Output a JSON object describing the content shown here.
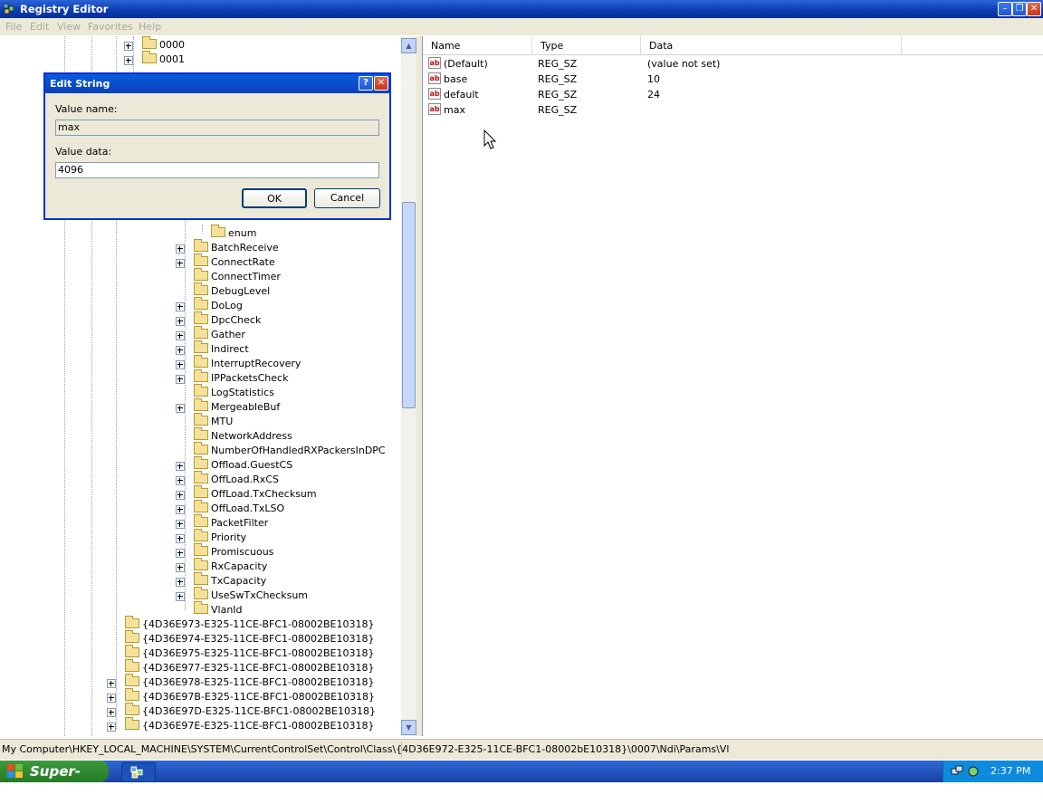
{
  "window": {
    "title": "Registry Editor"
  },
  "menu": [
    "File",
    "Edit",
    "View",
    "Favorites",
    "Help"
  ],
  "tree": {
    "top_keys": [
      "0000",
      "0001"
    ],
    "enum_label": "enum",
    "params": [
      "BatchReceive",
      "ConnectRate",
      "ConnectTimer",
      "DebugLevel",
      "DoLog",
      "DpcCheck",
      "Gather",
      "Indirect",
      "InterruptRecovery",
      "IPPacketsCheck",
      "LogStatistics",
      "MergeableBuf",
      "MTU",
      "NetworkAddress",
      "NumberOfHandledRXPackersInDPC",
      "Offload.GuestCS",
      "OffLoad.RxCS",
      "OffLoad.TxChecksum",
      "OffLoad.TxLSO",
      "PacketFilter",
      "Priority",
      "Promiscuous",
      "RxCapacity",
      "TxCapacity",
      "UseSwTxChecksum",
      "VlanId"
    ],
    "classes": [
      "{4D36E973-E325-11CE-BFC1-08002BE10318}",
      "{4D36E974-E325-11CE-BFC1-08002BE10318}",
      "{4D36E975-E325-11CE-BFC1-08002BE10318}",
      "{4D36E977-E325-11CE-BFC1-08002BE10318}",
      "{4D36E978-E325-11CE-BFC1-08002BE10318}",
      "{4D36E97B-E325-11CE-BFC1-08002BE10318}",
      "{4D36E97D-E325-11CE-BFC1-08002BE10318}",
      "{4D36E97E-E325-11CE-BFC1-08002BE10318}"
    ]
  },
  "list": {
    "columns": [
      "Name",
      "Type",
      "Data"
    ],
    "rows": [
      {
        "name": "(Default)",
        "type": "REG_SZ",
        "data": "(value not set)"
      },
      {
        "name": "base",
        "type": "REG_SZ",
        "data": "10"
      },
      {
        "name": "default",
        "type": "REG_SZ",
        "data": "24"
      },
      {
        "name": "max",
        "type": "REG_SZ",
        "data": ""
      }
    ]
  },
  "status_path": "My Computer\\HKEY_LOCAL_MACHINE\\SYSTEM\\CurrentControlSet\\Control\\Class\\{4D36E972-E325-11CE-BFC1-08002bE10318}\\0007\\Ndi\\Params\\Vl",
  "dialog": {
    "title": "Edit String",
    "value_name_label": "Value name:",
    "value_name": "max",
    "value_data_label": "Value data:",
    "value_data": "4096",
    "ok": "OK",
    "cancel": "Cancel"
  },
  "taskbar": {
    "start_label": "Super-Lite",
    "clock": "2:37 PM"
  }
}
